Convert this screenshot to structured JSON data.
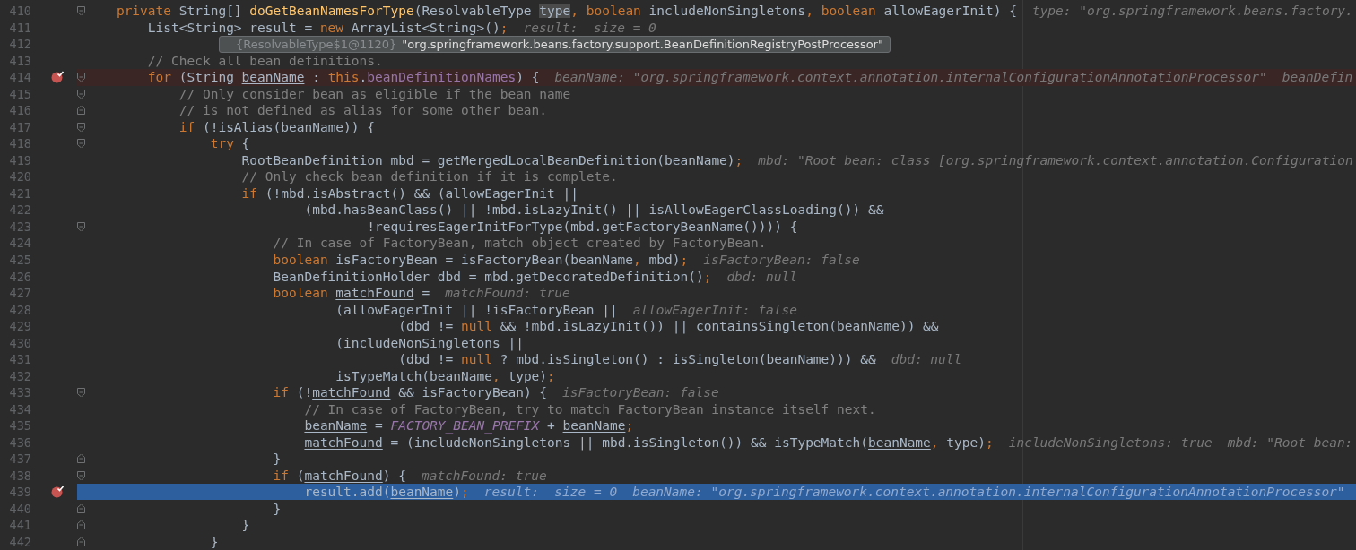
{
  "tooltip": {
    "object_id": "{ResolvableType$1@1120}",
    "value": "\"org.springframework.beans.factory.support.BeanDefinitionRegistryPostProcessor\""
  },
  "lines": [
    {
      "number": "410",
      "breakpoint": false,
      "current": false,
      "fold": {
        "kind": "start"
      },
      "code": [
        {
          "kind": "kw",
          "t": "    private "
        },
        {
          "kind": "plain",
          "t": "String[] "
        },
        {
          "kind": "decl",
          "t": "doGetBeanNamesForType"
        },
        {
          "kind": "plain",
          "t": "(ResolvableType "
        },
        {
          "kind": "hover",
          "t": "type"
        },
        {
          "kind": "punct",
          "t": ", "
        },
        {
          "kind": "kw",
          "t": "boolean "
        },
        {
          "kind": "plain",
          "t": "includeNonSingletons"
        },
        {
          "kind": "punct",
          "t": ", "
        },
        {
          "kind": "kw",
          "t": "boolean "
        },
        {
          "kind": "plain",
          "t": "allowEagerInit) {"
        }
      ],
      "hints": [
        "type: \"org.springframework.beans.factory."
      ]
    },
    {
      "number": "411",
      "breakpoint": false,
      "current": false,
      "code": [
        {
          "kind": "plain",
          "t": "        List<String> result = "
        },
        {
          "kind": "kw",
          "t": "new "
        },
        {
          "kind": "plain",
          "t": "ArrayList<String>()"
        },
        {
          "kind": "punct",
          "t": ";"
        }
      ],
      "hints": [
        "result:  size = 0"
      ]
    },
    {
      "number": "412",
      "breakpoint": false,
      "current": false
    },
    {
      "number": "413",
      "breakpoint": false,
      "current": false,
      "code": [
        {
          "kind": "comment",
          "t": "        // Check all bean definitions."
        }
      ]
    },
    {
      "number": "414",
      "breakpoint": true,
      "current": false,
      "fold": {
        "kind": "start"
      },
      "code": [
        {
          "kind": "kw",
          "t": "        for "
        },
        {
          "kind": "plain",
          "t": "(String "
        },
        {
          "kind": "var",
          "t": "beanName"
        },
        {
          "kind": "plain",
          "t": " : "
        },
        {
          "kind": "kw",
          "t": "this"
        },
        {
          "kind": "plain",
          "t": "."
        },
        {
          "kind": "field",
          "t": "beanDefinitionNames"
        },
        {
          "kind": "plain",
          "t": ") {"
        }
      ],
      "hints": [
        "beanName: \"org.springframework.context.annotation.internalConfigurationAnnotationProcessor\"",
        "beanDefin"
      ]
    },
    {
      "number": "415",
      "breakpoint": false,
      "current": false,
      "fold": {
        "kind": "start"
      },
      "code": [
        {
          "kind": "comment",
          "t": "            // Only consider bean as eligible if the bean name"
        }
      ]
    },
    {
      "number": "416",
      "breakpoint": false,
      "current": false,
      "fold": {
        "kind": "end"
      },
      "code": [
        {
          "kind": "comment",
          "t": "            // is not defined as alias for some other bean."
        }
      ]
    },
    {
      "number": "417",
      "breakpoint": false,
      "current": false,
      "fold": {
        "kind": "start"
      },
      "code": [
        {
          "kind": "kw",
          "t": "            if "
        },
        {
          "kind": "plain",
          "t": "(!isAlias(beanName)) {"
        }
      ]
    },
    {
      "number": "418",
      "breakpoint": false,
      "current": false,
      "fold": {
        "kind": "start"
      },
      "code": [
        {
          "kind": "kw",
          "t": "                try "
        },
        {
          "kind": "plain",
          "t": "{"
        }
      ]
    },
    {
      "number": "419",
      "breakpoint": false,
      "current": false,
      "code": [
        {
          "kind": "plain",
          "t": "                    RootBeanDefinition mbd = getMergedLocalBeanDefinition(beanName)"
        },
        {
          "kind": "punct",
          "t": ";"
        }
      ],
      "hints": [
        "mbd: \"Root bean: class [org.springframework.context.annotation.Configuration"
      ]
    },
    {
      "number": "420",
      "breakpoint": false,
      "current": false,
      "code": [
        {
          "kind": "comment",
          "t": "                    // Only check bean definition if it is complete."
        }
      ]
    },
    {
      "number": "421",
      "breakpoint": false,
      "current": false,
      "code": [
        {
          "kind": "kw",
          "t": "                    if "
        },
        {
          "kind": "plain",
          "t": "(!mbd.isAbstract() && (allowEagerInit ||"
        }
      ]
    },
    {
      "number": "422",
      "breakpoint": false,
      "current": false,
      "code": [
        {
          "kind": "plain",
          "t": "                            (mbd.hasBeanClass() || !mbd.isLazyInit() || isAllowEagerClassLoading()) &&"
        }
      ]
    },
    {
      "number": "423",
      "breakpoint": false,
      "current": false,
      "fold": {
        "kind": "start"
      },
      "code": [
        {
          "kind": "plain",
          "t": "                                    !requiresEagerInitForType(mbd.getFactoryBeanName()))) {"
        }
      ]
    },
    {
      "number": "424",
      "breakpoint": false,
      "current": false,
      "code": [
        {
          "kind": "comment",
          "t": "                        // In case of FactoryBean, match object created by FactoryBean."
        }
      ]
    },
    {
      "number": "425",
      "breakpoint": false,
      "current": false,
      "code": [
        {
          "kind": "kw",
          "t": "                        boolean "
        },
        {
          "kind": "plain",
          "t": "isFactoryBean = isFactoryBean(beanName"
        },
        {
          "kind": "punct",
          "t": ", "
        },
        {
          "kind": "plain",
          "t": "mbd)"
        },
        {
          "kind": "punct",
          "t": ";"
        }
      ],
      "hints": [
        "isFactoryBean: false"
      ]
    },
    {
      "number": "426",
      "breakpoint": false,
      "current": false,
      "code": [
        {
          "kind": "plain",
          "t": "                        BeanDefinitionHolder dbd = mbd.getDecoratedDefinition()"
        },
        {
          "kind": "punct",
          "t": ";"
        }
      ],
      "hints": [
        "dbd: null"
      ]
    },
    {
      "number": "427",
      "breakpoint": false,
      "current": false,
      "code": [
        {
          "kind": "kw",
          "t": "                        boolean "
        },
        {
          "kind": "var",
          "t": "matchFound"
        },
        {
          "kind": "plain",
          "t": " ="
        }
      ],
      "hints": [
        "matchFound: true"
      ]
    },
    {
      "number": "428",
      "breakpoint": false,
      "current": false,
      "code": [
        {
          "kind": "plain",
          "t": "                                (allowEagerInit || !isFactoryBean ||"
        }
      ],
      "hints": [
        "allowEagerInit: false"
      ]
    },
    {
      "number": "429",
      "breakpoint": false,
      "current": false,
      "code": [
        {
          "kind": "plain",
          "t": "                                        (dbd != "
        },
        {
          "kind": "kw",
          "t": "null"
        },
        {
          "kind": "plain",
          "t": " && !mbd.isLazyInit()) || containsSingleton(beanName)) &&"
        }
      ]
    },
    {
      "number": "430",
      "breakpoint": false,
      "current": false,
      "code": [
        {
          "kind": "plain",
          "t": "                                (includeNonSingletons ||"
        }
      ]
    },
    {
      "number": "431",
      "breakpoint": false,
      "current": false,
      "code": [
        {
          "kind": "plain",
          "t": "                                        (dbd != "
        },
        {
          "kind": "kw",
          "t": "null"
        },
        {
          "kind": "plain",
          "t": " ? mbd.isSingleton() : isSingleton(beanName))) &&"
        }
      ],
      "hints": [
        "dbd: null"
      ]
    },
    {
      "number": "432",
      "breakpoint": false,
      "current": false,
      "code": [
        {
          "kind": "plain",
          "t": "                                isTypeMatch(beanName"
        },
        {
          "kind": "punct",
          "t": ", "
        },
        {
          "kind": "plain",
          "t": "type)"
        },
        {
          "kind": "punct",
          "t": ";"
        }
      ]
    },
    {
      "number": "433",
      "breakpoint": false,
      "current": false,
      "fold": {
        "kind": "start"
      },
      "code": [
        {
          "kind": "kw",
          "t": "                        if "
        },
        {
          "kind": "plain",
          "t": "(!"
        },
        {
          "kind": "var",
          "t": "matchFound"
        },
        {
          "kind": "plain",
          "t": " && isFactoryBean) {"
        }
      ],
      "hints": [
        "isFactoryBean: false"
      ]
    },
    {
      "number": "434",
      "breakpoint": false,
      "current": false,
      "code": [
        {
          "kind": "comment",
          "t": "                            // In case of FactoryBean, try to match FactoryBean instance itself next."
        }
      ]
    },
    {
      "number": "435",
      "breakpoint": false,
      "current": false,
      "code": [
        {
          "kind": "var",
          "t": "                            beanName"
        },
        {
          "kind": "plain",
          "t": " = "
        },
        {
          "kind": "const",
          "t": "FACTORY_BEAN_PREFIX"
        },
        {
          "kind": "plain",
          "t": " + "
        },
        {
          "kind": "var",
          "t": "beanName"
        },
        {
          "kind": "punct",
          "t": ";"
        }
      ]
    },
    {
      "number": "436",
      "breakpoint": false,
      "current": false,
      "code": [
        {
          "kind": "var",
          "t": "                            matchFound"
        },
        {
          "kind": "plain",
          "t": " = (includeNonSingletons || mbd.isSingleton()) && isTypeMatch("
        },
        {
          "kind": "var",
          "t": "beanName"
        },
        {
          "kind": "punct",
          "t": ", "
        },
        {
          "kind": "plain",
          "t": "type)"
        },
        {
          "kind": "punct",
          "t": ";"
        }
      ],
      "hints": [
        "includeNonSingletons: true",
        "mbd: \"Root bean:"
      ]
    },
    {
      "number": "437",
      "breakpoint": false,
      "current": false,
      "fold": {
        "kind": "end"
      },
      "code": [
        {
          "kind": "plain",
          "t": "                        }"
        }
      ]
    },
    {
      "number": "438",
      "breakpoint": false,
      "current": false,
      "fold": {
        "kind": "start"
      },
      "code": [
        {
          "kind": "kw",
          "t": "                        if "
        },
        {
          "kind": "plain",
          "t": "("
        },
        {
          "kind": "var",
          "t": "matchFound"
        },
        {
          "kind": "plain",
          "t": ") {"
        }
      ],
      "hints": [
        "matchFound: true"
      ]
    },
    {
      "number": "439",
      "breakpoint": true,
      "current": true,
      "code": [
        {
          "kind": "plain",
          "t": "                            result.add("
        },
        {
          "kind": "var",
          "t": "beanName"
        },
        {
          "kind": "plain",
          "t": ")"
        },
        {
          "kind": "punct",
          "t": ";"
        }
      ],
      "hints": [
        "result:  size = 0",
        "beanName: \"org.springframework.context.annotation.internalConfigurationAnnotationProcessor\""
      ]
    },
    {
      "number": "440",
      "breakpoint": false,
      "current": false,
      "fold": {
        "kind": "end"
      },
      "code": [
        {
          "kind": "plain",
          "t": "                        }"
        }
      ]
    },
    {
      "number": "441",
      "breakpoint": false,
      "current": false,
      "fold": {
        "kind": "end"
      },
      "code": [
        {
          "kind": "plain",
          "t": "                    }"
        }
      ]
    },
    {
      "number": "442",
      "breakpoint": false,
      "current": false,
      "fold": {
        "kind": "end"
      },
      "code": [
        {
          "kind": "plain",
          "t": "                }"
        }
      ]
    }
  ]
}
